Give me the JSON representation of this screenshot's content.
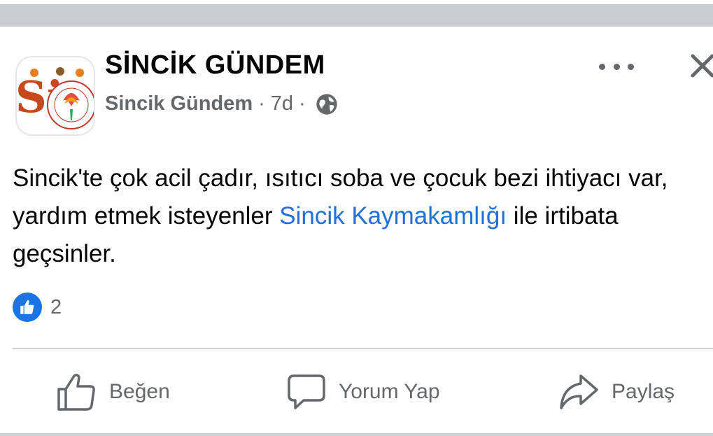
{
  "post": {
    "page_name": "SİNCİK GÜNDEM",
    "author": "Sincik Gündem",
    "separator": "·",
    "time": "7d",
    "privacy_icon": "globe-icon",
    "text_part1": "Sincik'te çok acil çadır, ısıtıcı soba ve çocuk bezi ihtiyacı var, yardım etmek isteyenler ",
    "mention": "Sincik Kaymakamlığı",
    "text_part2": "  ile irtibata geçsinler.",
    "reaction_count": "2"
  },
  "actions": {
    "like": "Beğen",
    "comment": "Yorum Yap",
    "share": "Paylaş"
  },
  "colors": {
    "link": "#216fdb",
    "like_blue": "#1b74e4",
    "secondary_text": "#65676b"
  }
}
